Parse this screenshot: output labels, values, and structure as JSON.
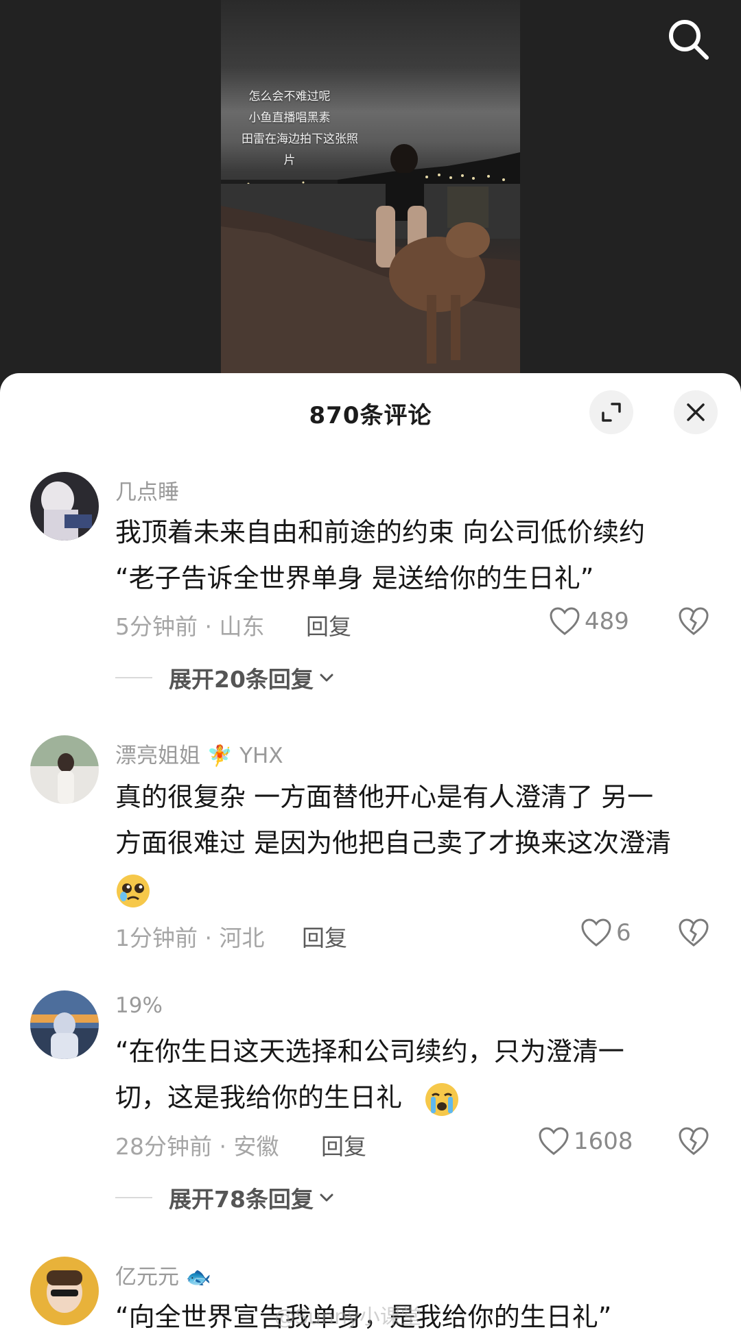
{
  "video": {
    "caption_lines": [
      "怎么会不难过呢",
      "小鱼直播唱黑素",
      "田雷在海边拍下这张照",
      "片"
    ]
  },
  "header": {
    "title": "870条评论"
  },
  "comments": [
    {
      "username": "几点睡",
      "text_lines": [
        "我顶着未来自由和前途的约束 向公司低价续约",
        "“老子告诉全世界单身 是送给你的生日礼”"
      ],
      "meta": "5分钟前 · 山东",
      "reply_label": "回复",
      "likes": "489",
      "expand_label": "展开20条回复"
    },
    {
      "username": "漂亮姐姐",
      "username_suffix": "YHX",
      "text_lines": [
        "真的很复杂 一方面替他开心是有人澄清了 另一",
        "方面很难过 是因为他把自己卖了才换来这次澄清"
      ],
      "meta": "1分钟前 · 河北",
      "reply_label": "回复",
      "likes": "6"
    },
    {
      "username": "19%",
      "text_lines": [
        "“在你生日这天选择和公司续约，只为澄清一",
        "切，这是我给你的生日礼"
      ],
      "meta": "28分钟前 · 安徽",
      "reply_label": "回复",
      "likes": "1608",
      "expand_label": "展开78条回复"
    },
    {
      "username": "亿元元",
      "text_lines": [
        "“向全世界宣告我单身，是我给你的生日礼”"
      ]
    }
  ],
  "watermark": "@Sunny小课堂",
  "icons": {
    "search": "search-icon",
    "expand": "expand-icon",
    "close": "close-icon",
    "like": "heart-icon",
    "dislike": "broken-heart-icon",
    "chevron": "chevron-down-icon"
  }
}
